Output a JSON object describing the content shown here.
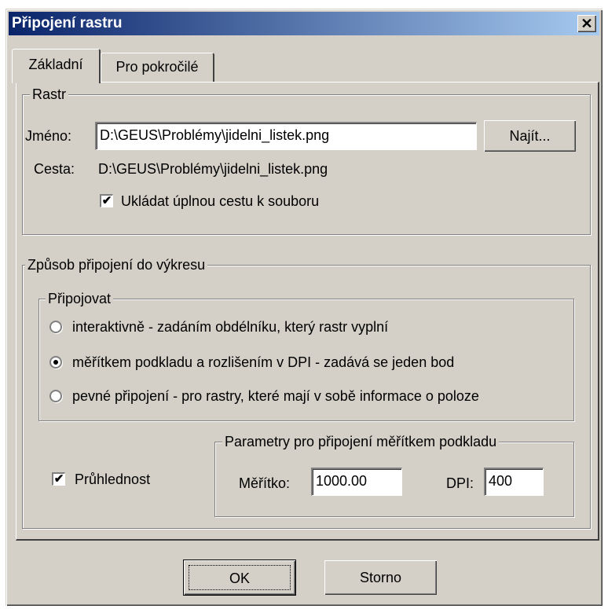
{
  "window": {
    "title": "Připojení rastru",
    "close_glyph": "✕"
  },
  "tabs": [
    {
      "label": "Základní",
      "selected": true
    },
    {
      "label": "Pro pokročilé",
      "selected": false
    }
  ],
  "rastr": {
    "group_label": "Rastr",
    "name_label": "Jméno:",
    "name_value": "D:\\GEUS\\Problémy\\jidelni_listek.png",
    "find_button": "Najít...",
    "path_label": "Cesta:",
    "path_value": "D:\\GEUS\\Problémy\\jidelni_listek.png",
    "save_full_path_label": "Ukládat úplnou cestu k souboru",
    "save_full_path_checked": true,
    "check_glyph": "✔"
  },
  "attach_mode": {
    "group_label": "Způsob připojení do výkresu",
    "connect_group_label": "Připojovat",
    "options": [
      {
        "label": "interaktivně - zadáním obdélníku, který rastr vyplní",
        "selected": false
      },
      {
        "label": "měřítkem podkladu a rozlišením v DPI - zadává se jeden bod",
        "selected": true
      },
      {
        "label": "pevné připojení - pro rastry, které mají v sobě informace o poloze",
        "selected": false
      }
    ],
    "transparency_label": "Průhlednost",
    "transparency_checked": true,
    "params_group_label": "Parametry pro připojení měřítkem podkladu",
    "scale_label": "Měřítko:",
    "scale_value": "1000.00",
    "dpi_label": "DPI:",
    "dpi_value": "400"
  },
  "buttons": {
    "ok": "OK",
    "cancel": "Storno"
  }
}
